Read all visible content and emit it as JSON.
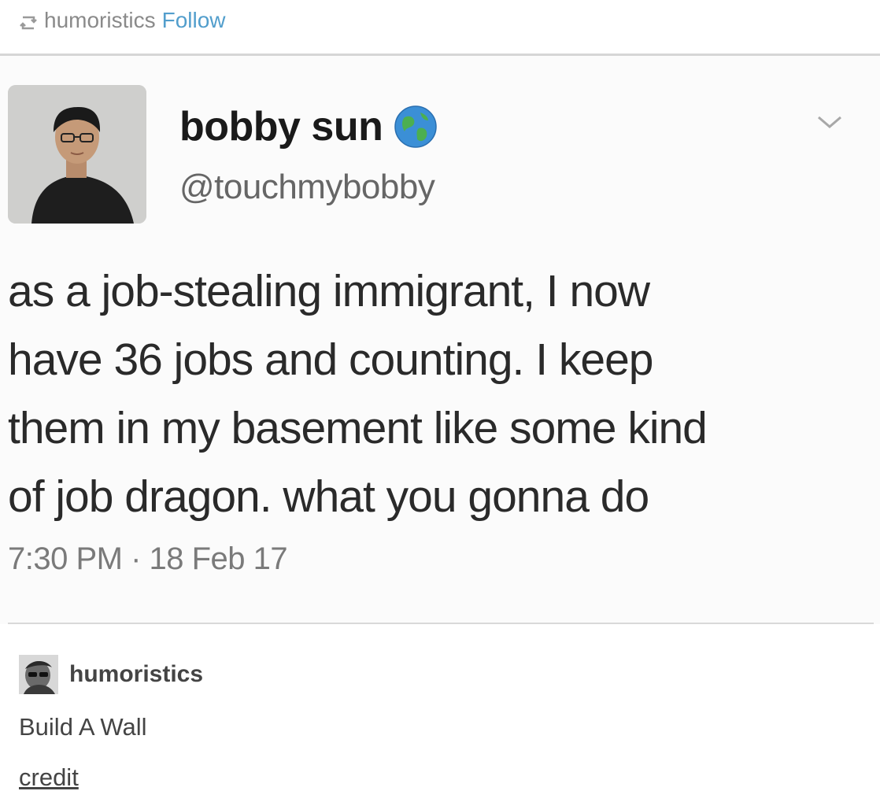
{
  "reblog_header": {
    "icon": "reblog-icon",
    "username": "humoristics",
    "follow_label": "Follow",
    "follow_color": "#529ecc"
  },
  "tweet": {
    "display_name": "bobby sun",
    "badge_icon": "globe-icon",
    "handle": "@touchmybobby",
    "menu_icon": "chevron-down-icon",
    "lines": [
      "as a job-stealing immigrant, I now",
      "have 36 jobs and counting. I keep",
      "them in my basement like some kind",
      "of job dragon. what you gonna do"
    ],
    "timestamp": "7:30 PM · 18 Feb 17"
  },
  "caption": {
    "username": "humoristics",
    "text": "Build A Wall",
    "link_label": "credit"
  }
}
